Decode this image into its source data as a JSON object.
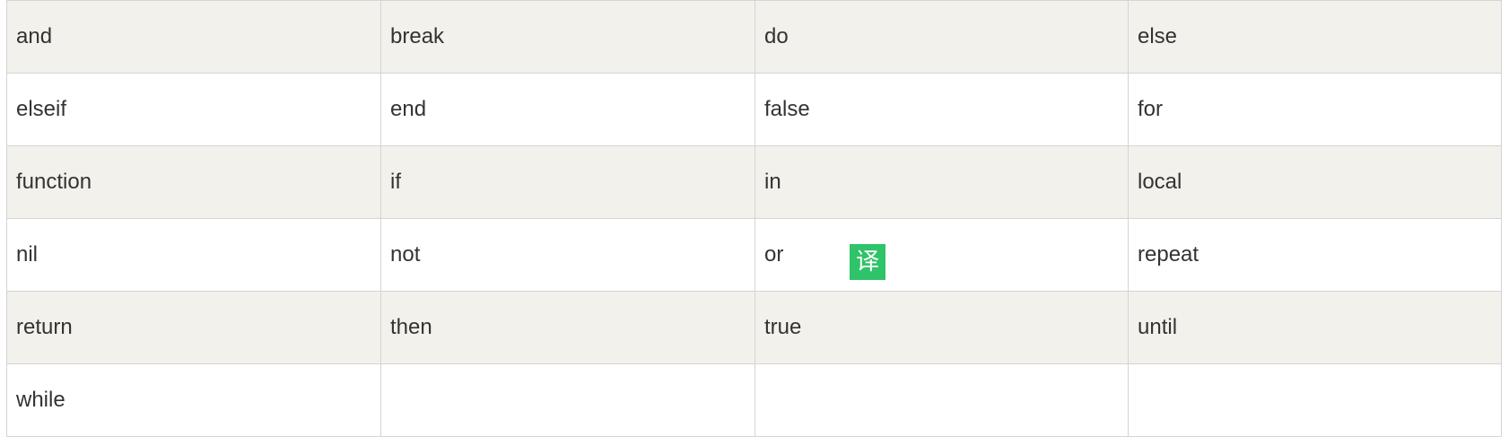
{
  "keywords_table": {
    "rows": [
      [
        "and",
        "break",
        "do",
        "else"
      ],
      [
        "elseif",
        "end",
        "false",
        "for"
      ],
      [
        "function",
        "if",
        "in",
        "local"
      ],
      [
        "nil",
        "not",
        "or",
        "repeat"
      ],
      [
        "return",
        "then",
        "true",
        "until"
      ],
      [
        "while",
        "",
        "",
        ""
      ]
    ]
  },
  "translate_badge": {
    "label": "译",
    "icon": "translate-icon",
    "color": "#2fc36a"
  }
}
